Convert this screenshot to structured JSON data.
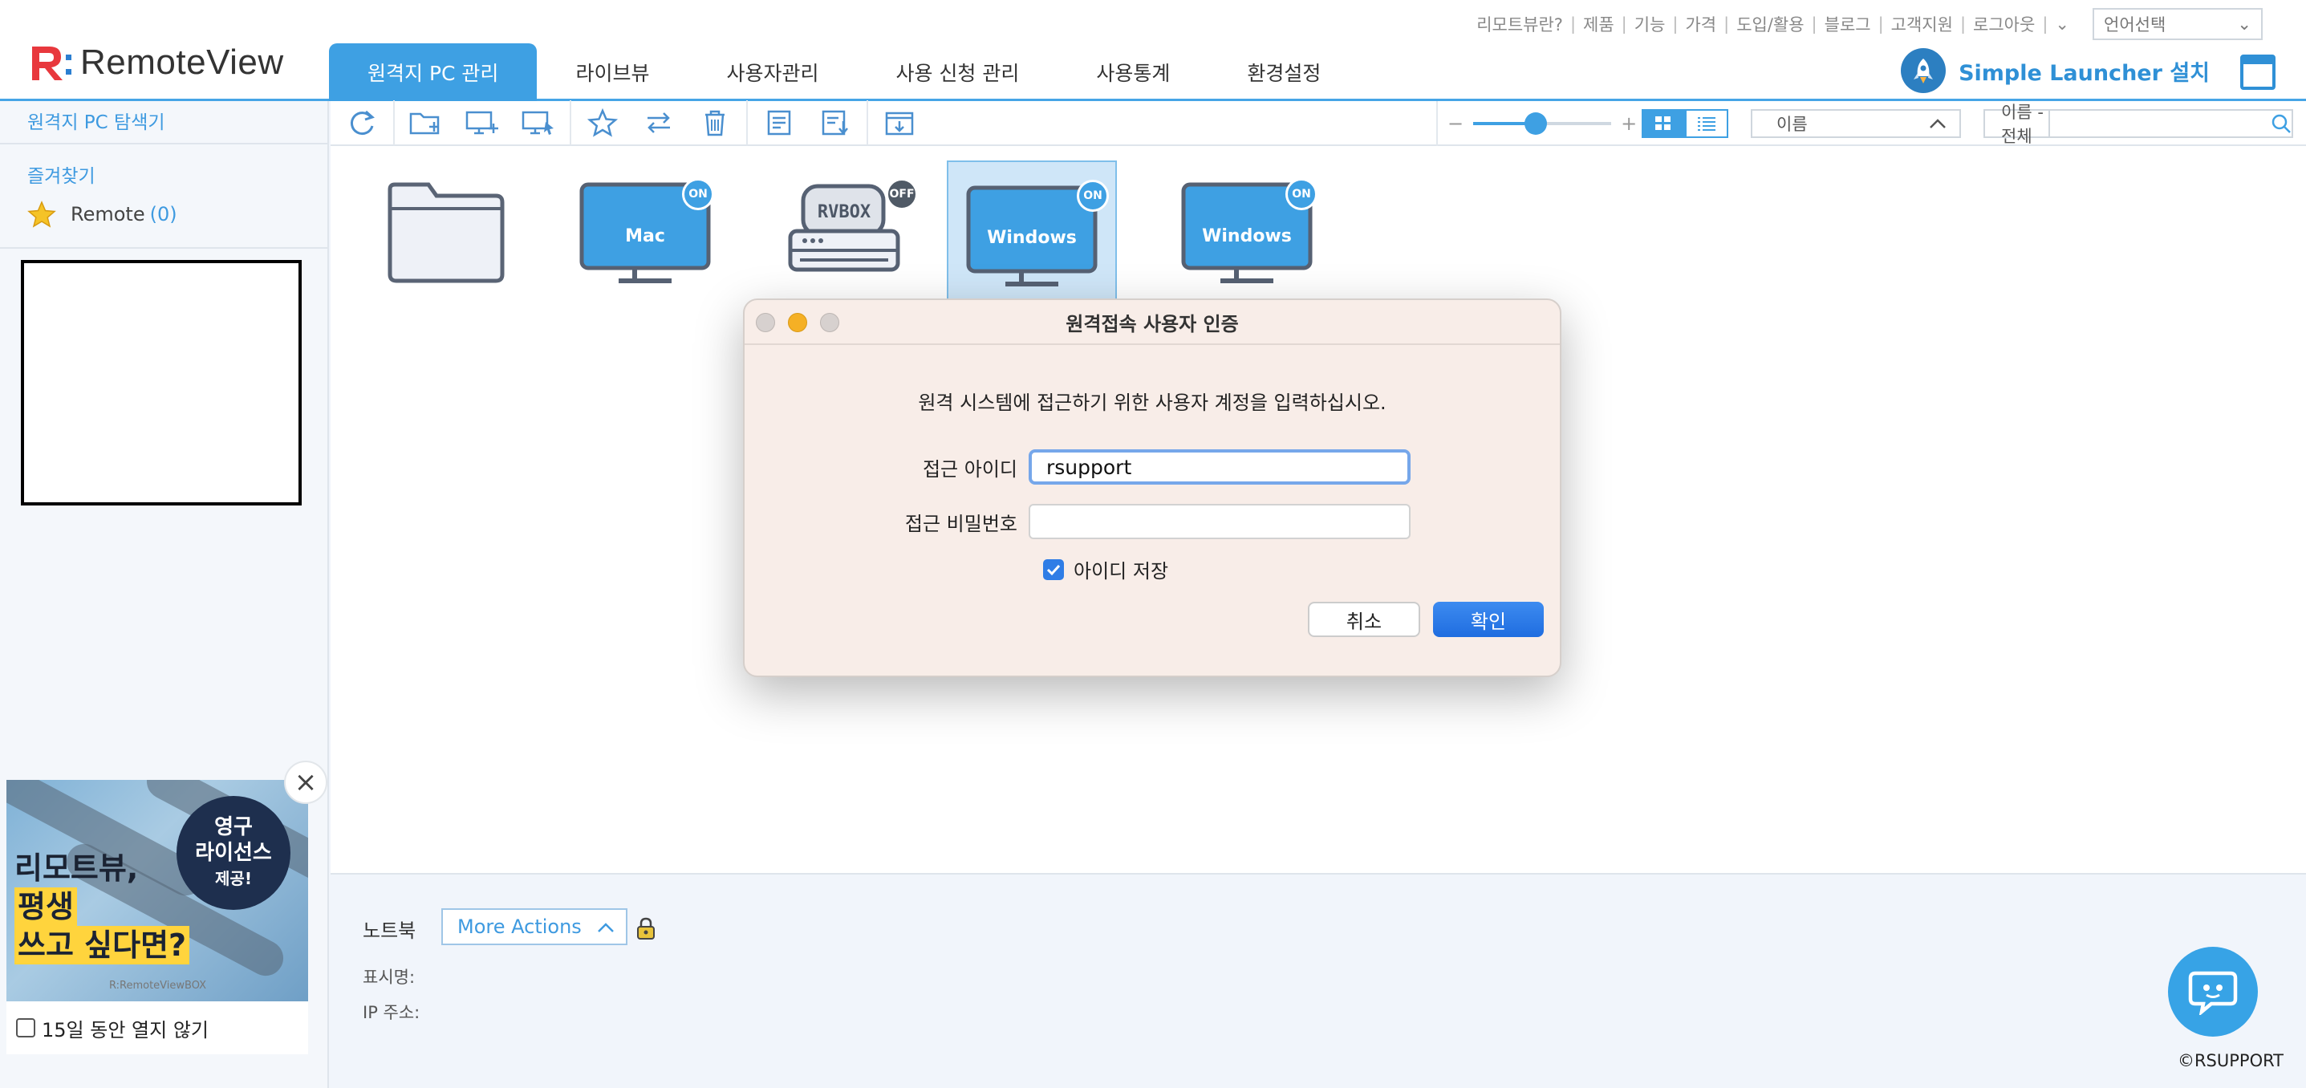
{
  "utility_links": [
    "리모트뷰란?",
    "제품",
    "기능",
    "가격",
    "도입/활용",
    "블로그",
    "고객지원",
    "로그아웃"
  ],
  "language_select": "언어선택",
  "logo_text": "RemoteView",
  "nav_tabs": [
    "원격지 PC 관리",
    "라이브뷰",
    "사용자관리",
    "사용 신청 관리",
    "사용통계",
    "환경설정"
  ],
  "active_tab": "원격지 PC 관리",
  "launcher_label": "Simple Launcher 설치",
  "sidebar": {
    "title": "원격지 PC 탐색기",
    "favorites_title": "즐겨찾기",
    "favorite_item": "Remote",
    "favorite_count": "(0)"
  },
  "toolbar": {
    "zoom_minus": "−",
    "zoom_plus": "+",
    "zoom_level": 0.45,
    "sort_value": "이름",
    "filter_label": "이름 - 전체"
  },
  "pcs": [
    {
      "type": "folder",
      "label": ""
    },
    {
      "type": "monitor",
      "label": "Mac",
      "status": "ON"
    },
    {
      "type": "rvbox",
      "label": "RVBOX",
      "status": "OFF"
    },
    {
      "type": "monitor",
      "label": "Windows",
      "status": "ON",
      "selected": true
    },
    {
      "type": "monitor",
      "label": "Windows",
      "status": "ON"
    }
  ],
  "info_panel": {
    "title": "노트북",
    "more_actions": "More Actions",
    "display_name_label": "표시명:",
    "ip_label": "IP 주소:"
  },
  "copyright": "©RSUPPORT",
  "ad": {
    "line1": "리모트뷰,",
    "line2": "평생",
    "line3": "쓰고 싶다면?",
    "badge_line1": "영구",
    "badge_line2": "라이선스",
    "badge_line3": "제공!",
    "brand": "R:RemoteViewBOX",
    "dont_show": "15일 동안 열지 않기"
  },
  "modal": {
    "title": "원격접속 사용자 인증",
    "message": "원격 시스템에 접근하기 위한 사용자 계정을 입력하십시오.",
    "id_label": "접근 아이디",
    "id_value": "rsupport",
    "pw_label": "접근 비밀번호",
    "pw_value": "",
    "save_id_label": "아이디 저장",
    "cancel_label": "취소",
    "ok_label": "확인"
  },
  "colors": {
    "accent": "#3ea0e3",
    "on_badge": "#3ea0e3",
    "off_badge": "#505a66",
    "ok_button": "#1f6de0",
    "logo_red": "#e8383d"
  }
}
